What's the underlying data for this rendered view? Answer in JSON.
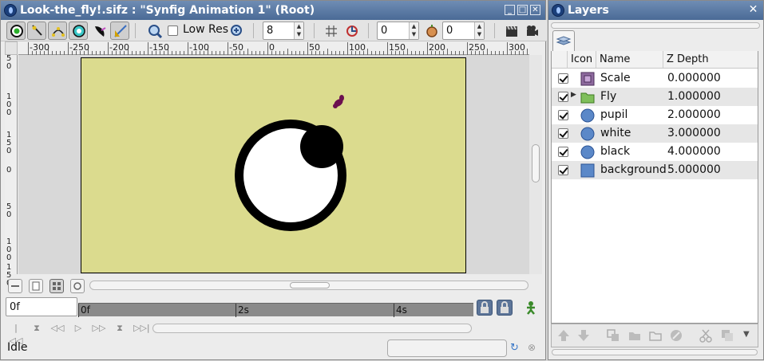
{
  "main_window": {
    "title": "Look-the_fly!.sifz : \"Synfig Animation 1\" (Root)",
    "toolbar": {
      "low_res_label": "Low Res",
      "low_res_checked": false,
      "quality_value": "8",
      "past_onion_value": "0",
      "future_onion_value": "0",
      "tools": [
        "transform-tool-icon",
        "smooth-move-icon",
        "scale-rotate-icon",
        "circle-tool-icon",
        "feather-draw-icon",
        "mirror-tool-icon"
      ]
    },
    "ruler_h": [
      "-300",
      "-250",
      "-200",
      "-150",
      "-100",
      "-50",
      "0",
      "50",
      "100",
      "150",
      "200",
      "250",
      "300"
    ],
    "ruler_v": [
      "50",
      "100",
      "150",
      "0",
      "50",
      "100",
      "150"
    ],
    "canvas": {
      "background": "#dbdb8e"
    },
    "time_field": "0f",
    "timebar_labels": [
      "0f",
      "2s",
      "4s"
    ],
    "status": "Idle"
  },
  "layers_window": {
    "title": "Layers",
    "columns": {
      "icon": "Icon",
      "name": "Name",
      "depth": "Z Depth"
    },
    "layers": [
      {
        "name": "Scale",
        "depth": "0.000000",
        "icon": "scale-layer-icon",
        "checked": true
      },
      {
        "name": "Fly",
        "depth": "1.000000",
        "icon": "group-folder-icon",
        "checked": true
      },
      {
        "name": "pupil",
        "depth": "2.000000",
        "icon": "circle-layer-icon",
        "checked": true
      },
      {
        "name": "white",
        "depth": "3.000000",
        "icon": "circle-layer-icon",
        "checked": true
      },
      {
        "name": "black",
        "depth": "4.000000",
        "icon": "circle-layer-icon",
        "checked": true
      },
      {
        "name": "background",
        "depth": "5.000000",
        "icon": "rectangle-layer-icon",
        "checked": true
      }
    ]
  }
}
